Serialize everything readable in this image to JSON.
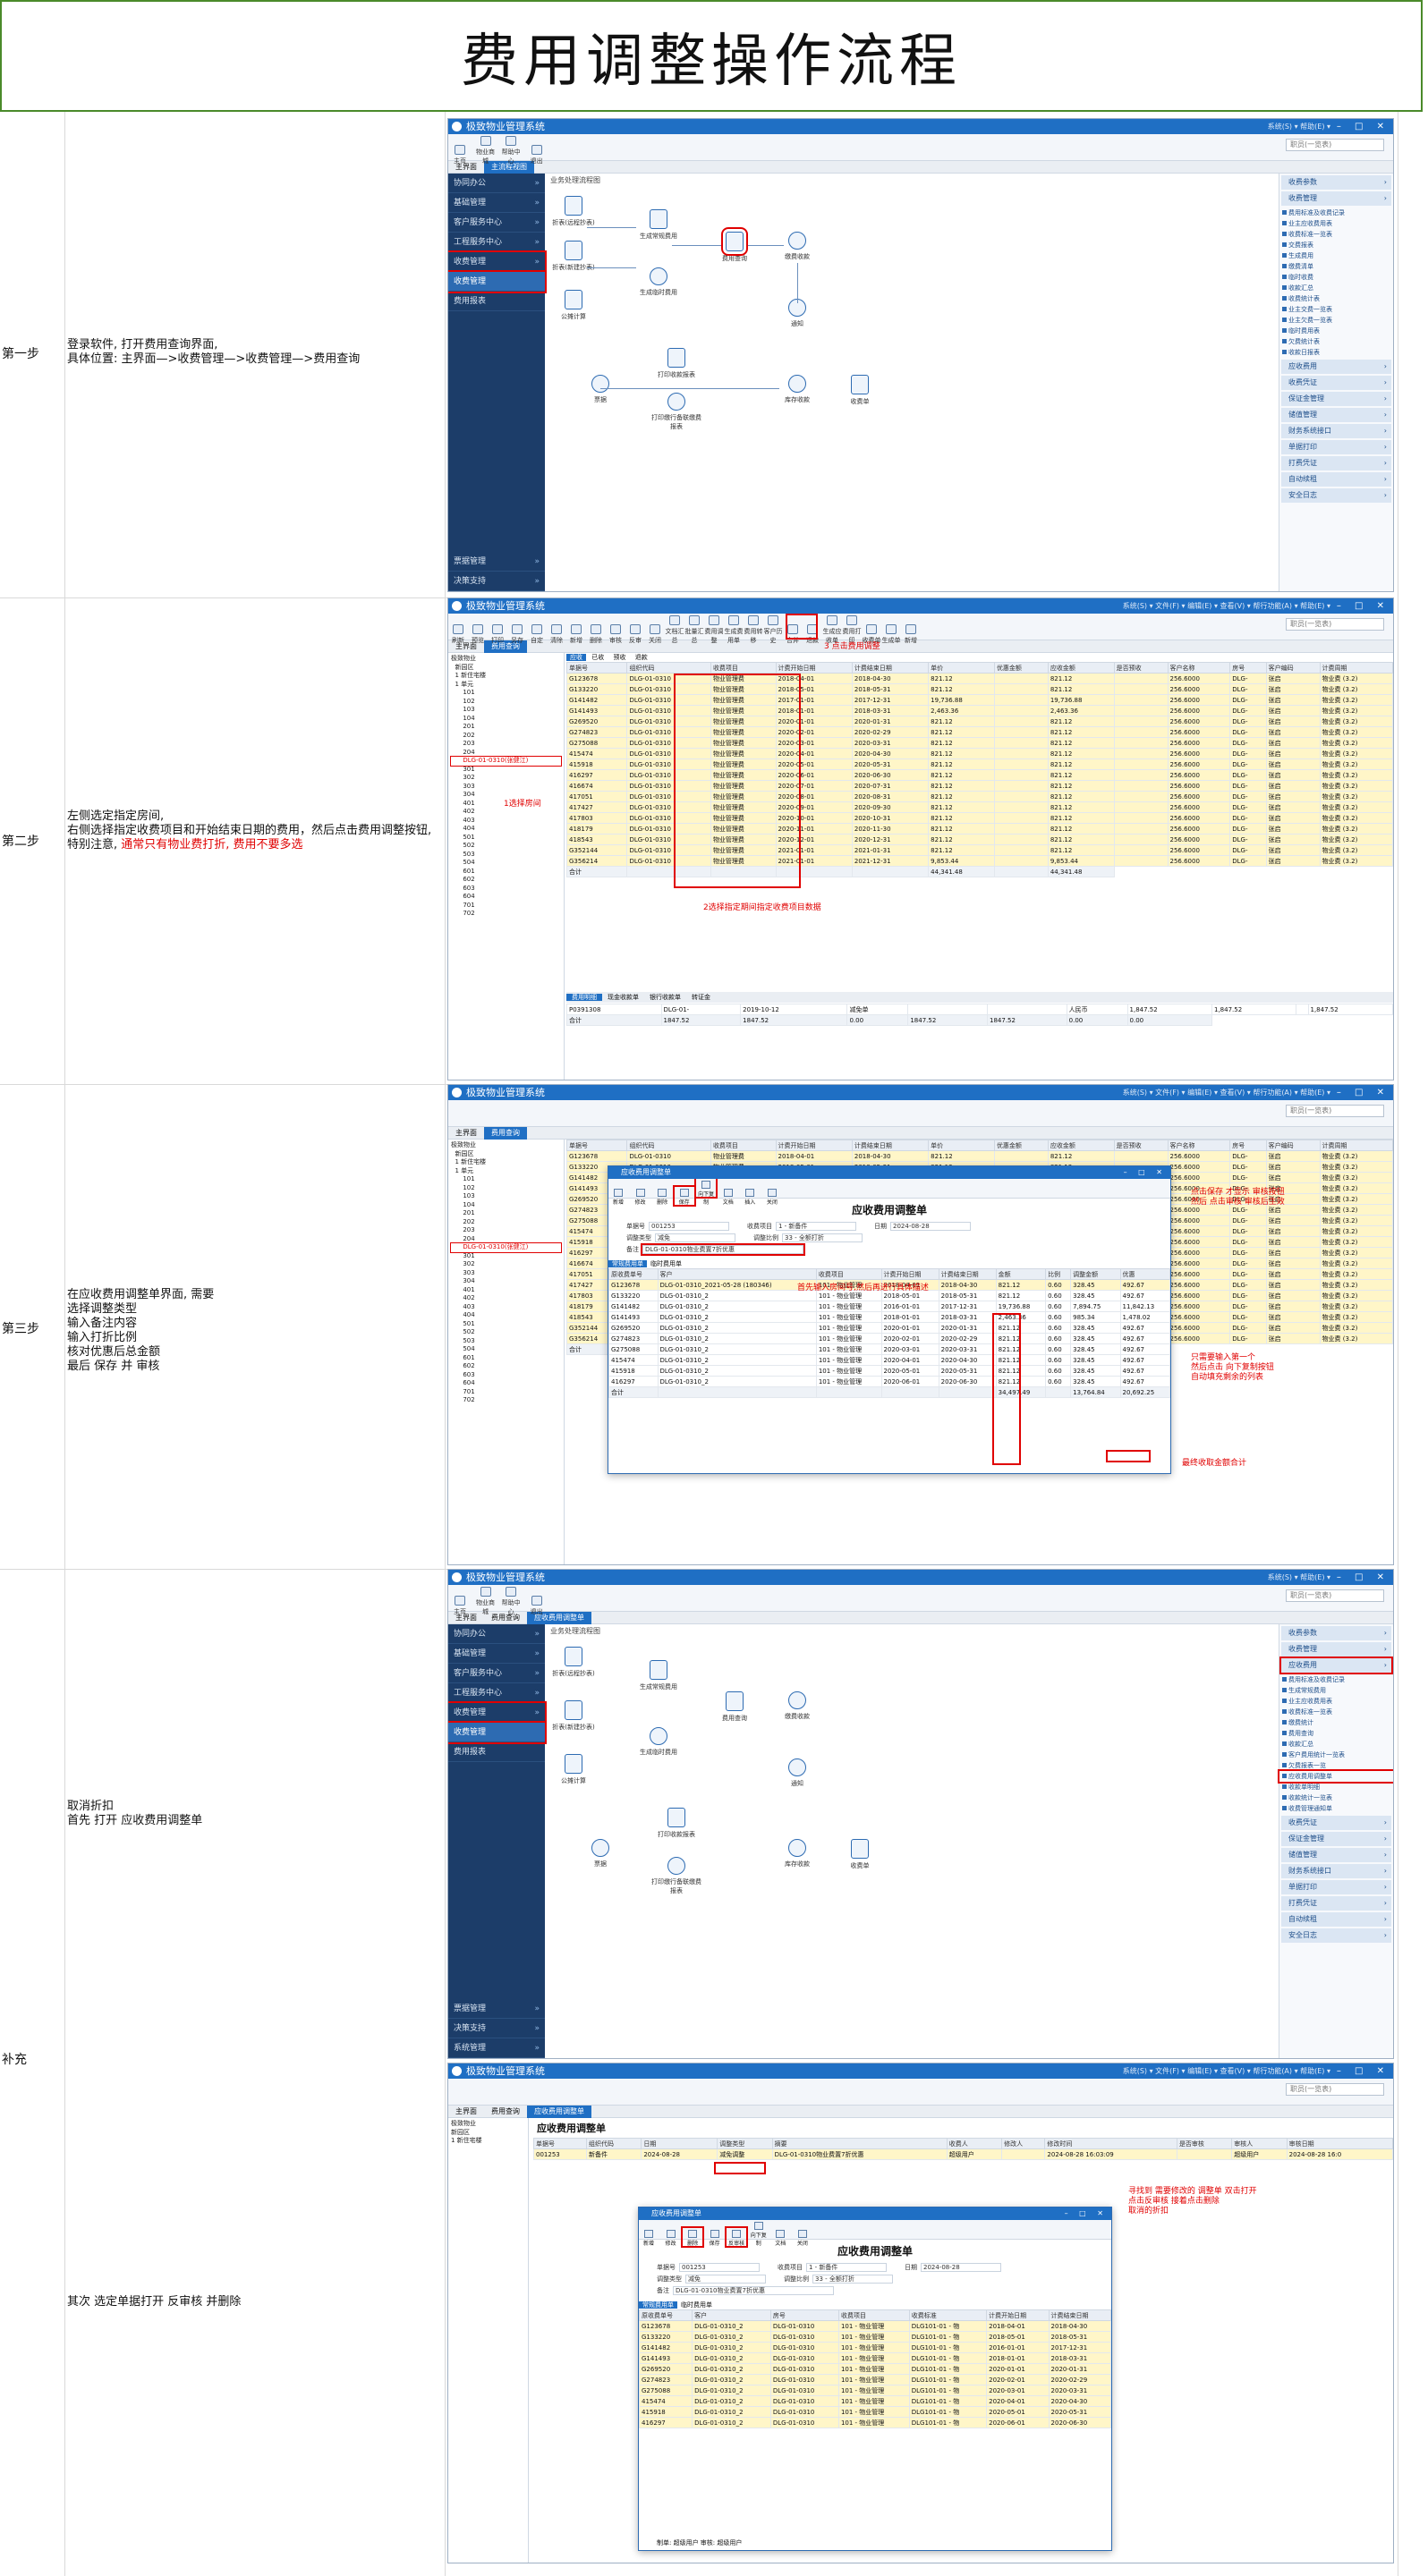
{
  "doc_title": "费用调整操作流程",
  "steps": [
    {
      "label": "第一步",
      "desc": "登录软件, 打开费用查询界面,\n具体位置: 主界面—>收费管理—>收费管理—>费用查询"
    },
    {
      "label": "第二步",
      "desc_a": "左侧选定指定房间,\n右侧选择指定收费项目和开始结束日期的费用，然后点击费用调整按钮,\n特别注意, ",
      "desc_red": "通常只有物业费打折, 费用不要多选"
    },
    {
      "label": "第三步",
      "desc": "在应收费用调整单界面, 需要\n选择调整类型\n输入备注内容\n输入打折比例\n核对优惠后总金额\n最后  保存  并  审核"
    },
    {
      "label": "补充",
      "desc_a": "取消折扣\n首先  打开  应收费用调整单",
      "desc_b": "其次  选定单据打开  反审核  并删除"
    }
  ],
  "app": {
    "title": "极致物业管理系统",
    "menus": "系统(S) ▾  帮助(E) ▾",
    "window_controls": "– □ ✕",
    "menus_full": "系统(S) ▾  文件(F) ▾  编辑(E) ▾  查看(V) ▾  帮行功能(A) ▾  帮助(E) ▾",
    "search_placeholder": "职员(一览表)",
    "home_tab": "主界面",
    "main_tab": "主流程视图",
    "fee_tab": "费用查询",
    "adjust_tab": "应收费用调整单"
  },
  "toolbar1": [
    "主页",
    "物业商城",
    "帮助中心",
    "退出"
  ],
  "toolbar2": [
    "刷新",
    "预览",
    "打印",
    "另存",
    "自定",
    "清除",
    "新增",
    "删除",
    "审核",
    "反审",
    "关闭",
    "文档汇总",
    "批量汇总",
    "费用调整",
    "生成费用单",
    "费用转移",
    "客户历史",
    "合并",
    "退款",
    "生成应收单",
    "费用打印",
    "收费单",
    "生成单",
    "新增",
    "关闭"
  ],
  "sidebar": {
    "items": [
      "协同办公",
      "基础管理",
      "客户服务中心",
      "工程服务中心",
      "收费管理",
      "收费管理",
      "费用报表"
    ],
    "bottom": [
      "票据管理",
      "决策支持",
      "系统管理"
    ]
  },
  "flow": {
    "header": "业务处理流程图",
    "nodes": [
      "折表(远程抄表)",
      "折表(新建抄表)",
      "公摊计算",
      "生成常规费用",
      "生成临时费用",
      "费用查询",
      "缴费收款",
      "打印收款报表",
      "打印缴行备联缴费报表",
      "票据",
      "库存收款",
      "通知",
      "滞纳金",
      "收费单"
    ]
  },
  "rpanel": {
    "sections": [
      "收费参数",
      "收费管理"
    ],
    "links": [
      "费用标准及收费记录",
      "业主应收费用表",
      "收费标准一览表",
      "交费报表",
      "生成费用",
      "缴费清单",
      "临时收费",
      "收款汇总",
      "收费统计表",
      "业主交费一览表",
      "业主欠费一览表",
      "临时费用表",
      "欠费统计表",
      "收款日报表"
    ],
    "links_b": [
      "费用标准及收费记录",
      "生成常规费用",
      "业主应收费用表",
      "收费标准一览表",
      "缴费统计",
      "费用查询",
      "收款汇总",
      "客户费用统计一览表",
      "欠费报表一览",
      "应收费用调整单",
      "收款单明细",
      "收款统计一览表",
      "收费管理通知单"
    ],
    "sections_bottom": [
      "应收费用",
      "收费凭证",
      "保证金管理",
      "储值管理",
      "财务系统接口",
      "单据打印",
      "打费凭证",
      "自动续租",
      "安全日志"
    ]
  },
  "tree": {
    "root": "极致物业",
    "nodes": [
      "新园区",
      "1 新住宅楼",
      "1 单元",
      "101",
      "102",
      "103",
      "104",
      "201",
      "202",
      "203",
      "204",
      "301",
      "302",
      "303",
      "304",
      "401",
      "402",
      "403",
      "404",
      "501",
      "502",
      "503",
      "504",
      "601",
      "602",
      "603",
      "604",
      "701",
      "702"
    ],
    "highlight": "DLG-01-0310(张健江)",
    "red_note": "1选择房间"
  },
  "grid_tabs": [
    "应收",
    "已收",
    "预收",
    "退款"
  ],
  "grid": {
    "columns": [
      "单据号",
      "组织代码",
      "收费项目",
      "计费开始日期",
      "计费结束日期",
      "单价",
      "优惠金额",
      "应收金额",
      "是否预收",
      "客户名称",
      "房号",
      "客户编码",
      "计费周期",
      "收费方式",
      "收款人"
    ],
    "rows": [
      [
        "G123678",
        "DLG-01-0310",
        "物业管理费",
        "2018-04-01",
        "2018-04-30",
        "821.12",
        "",
        "821.12",
        "",
        "256.6000",
        "DLG-",
        "张启",
        "物业费 (3.2)"
      ],
      [
        "G133220",
        "DLG-01-0310",
        "物业管理费",
        "2018-05-01",
        "2018-05-31",
        "821.12",
        "",
        "821.12",
        "",
        "256.6000",
        "DLG-",
        "张启",
        "物业费 (3.2)"
      ],
      [
        "G141482",
        "DLG-01-0310",
        "物业管理费",
        "2017-01-01",
        "2017-12-31",
        "19,736.88",
        "",
        "19,736.88",
        "",
        "256.6000",
        "DLG-",
        "张启",
        "物业费 (3.2)"
      ],
      [
        "G141493",
        "DLG-01-0310",
        "物业管理费",
        "2018-01-01",
        "2018-03-31",
        "2,463.36",
        "",
        "2,463.36",
        "",
        "256.6000",
        "DLG-",
        "张启",
        "物业费 (3.2)"
      ],
      [
        "G269520",
        "DLG-01-0310",
        "物业管理费",
        "2020-01-01",
        "2020-01-31",
        "821.12",
        "",
        "821.12",
        "",
        "256.6000",
        "DLG-",
        "张启",
        "物业费 (3.2)"
      ],
      [
        "G274823",
        "DLG-01-0310",
        "物业管理费",
        "2020-02-01",
        "2020-02-29",
        "821.12",
        "",
        "821.12",
        "",
        "256.6000",
        "DLG-",
        "张启",
        "物业费 (3.2)"
      ],
      [
        "G275088",
        "DLG-01-0310",
        "物业管理费",
        "2020-03-01",
        "2020-03-31",
        "821.12",
        "",
        "821.12",
        "",
        "256.6000",
        "DLG-",
        "张启",
        "物业费 (3.2)"
      ],
      [
        "415474",
        "DLG-01-0310",
        "物业管理费",
        "2020-04-01",
        "2020-04-30",
        "821.12",
        "",
        "821.12",
        "",
        "256.6000",
        "DLG-",
        "张启",
        "物业费 (3.2)"
      ],
      [
        "415918",
        "DLG-01-0310",
        "物业管理费",
        "2020-05-01",
        "2020-05-31",
        "821.12",
        "",
        "821.12",
        "",
        "256.6000",
        "DLG-",
        "张启",
        "物业费 (3.2)"
      ],
      [
        "416297",
        "DLG-01-0310",
        "物业管理费",
        "2020-06-01",
        "2020-06-30",
        "821.12",
        "",
        "821.12",
        "",
        "256.6000",
        "DLG-",
        "张启",
        "物业费 (3.2)"
      ],
      [
        "416674",
        "DLG-01-0310",
        "物业管理费",
        "2020-07-01",
        "2020-07-31",
        "821.12",
        "",
        "821.12",
        "",
        "256.6000",
        "DLG-",
        "张启",
        "物业费 (3.2)"
      ],
      [
        "417051",
        "DLG-01-0310",
        "物业管理费",
        "2020-08-01",
        "2020-08-31",
        "821.12",
        "",
        "821.12",
        "",
        "256.6000",
        "DLG-",
        "张启",
        "物业费 (3.2)"
      ],
      [
        "417427",
        "DLG-01-0310",
        "物业管理费",
        "2020-09-01",
        "2020-09-30",
        "821.12",
        "",
        "821.12",
        "",
        "256.6000",
        "DLG-",
        "张启",
        "物业费 (3.2)"
      ],
      [
        "417803",
        "DLG-01-0310",
        "物业管理费",
        "2020-10-01",
        "2020-10-31",
        "821.12",
        "",
        "821.12",
        "",
        "256.6000",
        "DLG-",
        "张启",
        "物业费 (3.2)"
      ],
      [
        "418179",
        "DLG-01-0310",
        "物业管理费",
        "2020-11-01",
        "2020-11-30",
        "821.12",
        "",
        "821.12",
        "",
        "256.6000",
        "DLG-",
        "张启",
        "物业费 (3.2)"
      ],
      [
        "418543",
        "DLG-01-0310",
        "物业管理费",
        "2020-12-01",
        "2020-12-31",
        "821.12",
        "",
        "821.12",
        "",
        "256.6000",
        "DLG-",
        "张启",
        "物业费 (3.2)"
      ],
      [
        "G352144",
        "DLG-01-0310",
        "物业管理费",
        "2021-01-01",
        "2021-01-31",
        "821.12",
        "",
        "821.12",
        "",
        "256.6000",
        "DLG-",
        "张启",
        "物业费 (3.2)"
      ],
      [
        "G356214",
        "DLG-01-0310",
        "物业管理费",
        "2021-01-01",
        "2021-12-31",
        "9,853.44",
        "",
        "9,853.44",
        "",
        "256.6000",
        "DLG-",
        "张启",
        "物业费 (3.2)"
      ]
    ],
    "sum_label": "合计",
    "sum_value": "44,341.48",
    "sum_value2": "44,341.48"
  },
  "annotations": {
    "step2_top": "3 点击费用调整",
    "step2_bottom": "2选择指定期间指定收费项目数据",
    "step3_a": "点击保存 才显示 审核按钮\n然后 点击审核 审核后生效",
    "step3_b": "首先输入房间号,然后再进行具体描述",
    "step3_c": "只需要输入第一个\n然后点击 向下复制按钮\n自动填充剩余的列表",
    "step3_d": "最终收取金额合计",
    "supp": "寻找到 需要修改的 调整单 双击打开\n点击反审核  接着点击删除\n取消的折扣"
  },
  "bottom_tabs": [
    "费用明细",
    "现金收款单",
    "银行收款单",
    "转证金"
  ],
  "bottom_row": [
    "P0391308",
    "DLG-01-",
    "2019-10-12",
    "减免单",
    "",
    "",
    "人民币",
    "1,847.52",
    "1,847.52",
    "",
    "1,847.52"
  ],
  "bottom_sum": [
    "合计",
    "1847.52",
    "1847.52",
    "0.00",
    "1847.52",
    "1847.52",
    "0.00",
    "0.00"
  ],
  "dialog": {
    "title": "应收费用调整单",
    "header": "应收费用调整单",
    "fields": [
      "单据号",
      "收费项目",
      "日期",
      "调整类型",
      "调整比例",
      "备注"
    ],
    "values": [
      "001253",
      "1 - 新备件",
      "2024-08-28",
      "减免",
      "33 - 全额打折",
      "2024-08-28"
    ],
    "note_value": "DLG-01-0310物业费置7折优惠",
    "grid_tabs": [
      "常规费用单",
      "临时费用单"
    ],
    "columns": [
      "原收费单号",
      "客户",
      "收费项目",
      "计费开始日期",
      "计费结束日期",
      "金额",
      "比例",
      "调整金额",
      "优惠"
    ],
    "rows": [
      [
        "G123678",
        "DLG-01-0310_2021-05-28 (180346)",
        "101 - 物业管理",
        "2018-04-01",
        "2018-04-30",
        "821.12",
        "0.60",
        "328.45",
        "492.67"
      ],
      [
        "G133220",
        "DLG-01-0310_2",
        "101 - 物业管理",
        "2018-05-01",
        "2018-05-31",
        "821.12",
        "0.60",
        "328.45",
        "492.67"
      ],
      [
        "G141482",
        "DLG-01-0310_2",
        "101 - 物业管理",
        "2016-01-01",
        "2017-12-31",
        "19,736.88",
        "0.60",
        "7,894.75",
        "11,842.13"
      ],
      [
        "G141493",
        "DLG-01-0310_2",
        "101 - 物业管理",
        "2018-01-01",
        "2018-03-31",
        "2,463.36",
        "0.60",
        "985.34",
        "1,478.02"
      ],
      [
        "G269520",
        "DLG-01-0310_2",
        "101 - 物业管理",
        "2020-01-01",
        "2020-01-31",
        "821.12",
        "0.60",
        "328.45",
        "492.67"
      ],
      [
        "G274823",
        "DLG-01-0310_2",
        "101 - 物业管理",
        "2020-02-01",
        "2020-02-29",
        "821.12",
        "0.60",
        "328.45",
        "492.67"
      ],
      [
        "G275088",
        "DLG-01-0310_2",
        "101 - 物业管理",
        "2020-03-01",
        "2020-03-31",
        "821.12",
        "0.60",
        "328.45",
        "492.67"
      ],
      [
        "415474",
        "DLG-01-0310_2",
        "101 - 物业管理",
        "2020-04-01",
        "2020-04-30",
        "821.12",
        "0.60",
        "328.45",
        "492.67"
      ],
      [
        "415918",
        "DLG-01-0310_2",
        "101 - 物业管理",
        "2020-05-01",
        "2020-05-31",
        "821.12",
        "0.60",
        "328.45",
        "492.67"
      ],
      [
        "416297",
        "DLG-01-0310_2",
        "101 - 物业管理",
        "2020-06-01",
        "2020-06-30",
        "821.12",
        "0.60",
        "328.45",
        "492.67"
      ]
    ],
    "sum_label": "合计",
    "sum_amount": "34,497.49",
    "sum_adjust": "13,764.84",
    "sum_discount": "20,692.25"
  },
  "list_adjust": {
    "title": "应收费用调整单",
    "columns": [
      "单据号",
      "组织代码",
      "日期",
      "调整类型",
      "摘要",
      "收费人",
      "修改人",
      "修改时间",
      "是否审核",
      "审核人",
      "审核日期"
    ],
    "row": [
      "001253",
      "新备件",
      "2024-08-28",
      "减免调整",
      "DLG-01-0310物业费置7折优惠",
      "超级用户",
      "",
      "2024-08-28 16:03:09",
      "",
      "超级用户",
      "2024-08-28 16:0"
    ],
    "dialog_rows": [
      [
        "G123678",
        "DLG-01-0310_2",
        "DLG-01-0310",
        "101 - 物业管理",
        "DLG101-01 - 物",
        "2018-04-01",
        "2018-04-30"
      ],
      [
        "G133220",
        "DLG-01-0310_2",
        "DLG-01-0310",
        "101 - 物业管理",
        "DLG101-01 - 物",
        "2018-05-01",
        "2018-05-31"
      ],
      [
        "G141482",
        "DLG-01-0310_2",
        "DLG-01-0310",
        "101 - 物业管理",
        "DLG101-01 - 物",
        "2016-01-01",
        "2017-12-31"
      ],
      [
        "G141493",
        "DLG-01-0310_2",
        "DLG-01-0310",
        "101 - 物业管理",
        "DLG101-01 - 物",
        "2018-01-01",
        "2018-03-31"
      ],
      [
        "G269520",
        "DLG-01-0310_2",
        "DLG-01-0310",
        "101 - 物业管理",
        "DLG101-01 - 物",
        "2020-01-01",
        "2020-01-31"
      ],
      [
        "G274823",
        "DLG-01-0310_2",
        "DLG-01-0310",
        "101 - 物业管理",
        "DLG101-01 - 物",
        "2020-02-01",
        "2020-02-29"
      ],
      [
        "G275088",
        "DLG-01-0310_2",
        "DLG-01-0310",
        "101 - 物业管理",
        "DLG101-01 - 物",
        "2020-03-01",
        "2020-03-31"
      ],
      [
        "415474",
        "DLG-01-0310_2",
        "DLG-01-0310",
        "101 - 物业管理",
        "DLG101-01 - 物",
        "2020-04-01",
        "2020-04-30"
      ],
      [
        "415918",
        "DLG-01-0310_2",
        "DLG-01-0310",
        "101 - 物业管理",
        "DLG101-01 - 物",
        "2020-05-01",
        "2020-05-31"
      ],
      [
        "416297",
        "DLG-01-0310_2",
        "DLG-01-0310",
        "101 - 物业管理",
        "DLG101-01 - 物",
        "2020-06-01",
        "2020-06-30"
      ]
    ],
    "footer": "制单: 超级用户                审核: 超级用户"
  }
}
